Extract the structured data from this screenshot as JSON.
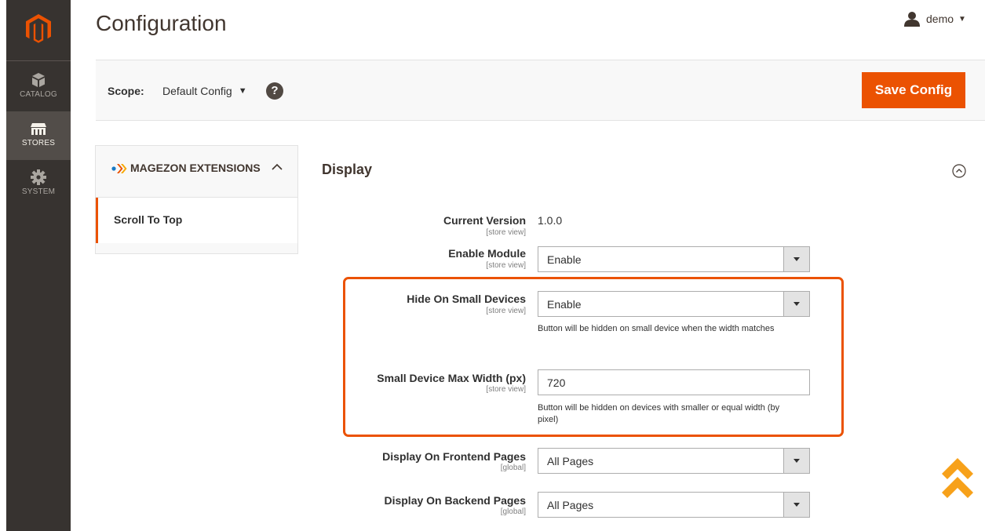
{
  "header": {
    "title": "Configuration",
    "user": "demo"
  },
  "sidebar": {
    "items": [
      {
        "label": "CATALOG",
        "icon": "cube-icon"
      },
      {
        "label": "STORES",
        "icon": "store-icon"
      },
      {
        "label": "SYSTEM",
        "icon": "gear-icon"
      }
    ]
  },
  "scope": {
    "label": "Scope:",
    "value": "Default Config",
    "help": "?"
  },
  "actions": {
    "save_label": "Save Config"
  },
  "tabs": {
    "group": "MAGEZON EXTENSIONS",
    "items": [
      "Scroll To Top"
    ]
  },
  "section": {
    "title": "Display",
    "fields": {
      "current_version": {
        "label": "Current Version",
        "scope": "[store view]",
        "value": "1.0.0"
      },
      "enable_module": {
        "label": "Enable Module",
        "scope": "[store view]",
        "value": "Enable"
      },
      "hide_small": {
        "label": "Hide On Small Devices",
        "scope": "[store view]",
        "value": "Enable",
        "note": "Button will be hidden on small device when the width matches"
      },
      "max_width": {
        "label": "Small Device Max Width (px)",
        "scope": "[store view]",
        "value": "720",
        "note": "Button will be hidden on devices with smaller or equal width (by pixel)"
      },
      "frontend_pages": {
        "label": "Display On Frontend Pages",
        "scope": "[global]",
        "value": "All Pages"
      },
      "backend_pages": {
        "label": "Display On Backend Pages",
        "scope": "[global]",
        "value": "All Pages"
      }
    }
  },
  "colors": {
    "accent": "#eb5202",
    "sidebar": "#373330"
  }
}
